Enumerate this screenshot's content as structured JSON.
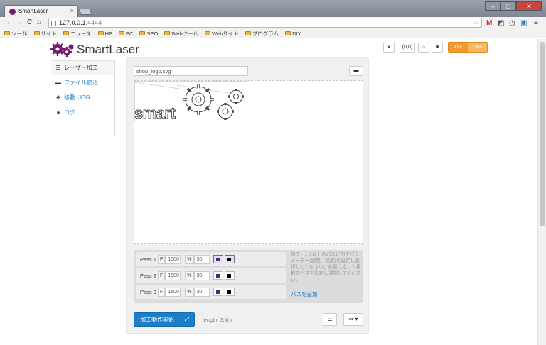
{
  "browser": {
    "tab_title": "SmartLaser",
    "tab_close": "×",
    "url_host": "127.0.0.1",
    "url_port": ":4444",
    "win_min": "–",
    "win_max": "□",
    "win_close": "✕",
    "back_icon": "←",
    "forward_icon": "→",
    "reload_icon": "C",
    "home_icon": "⌂",
    "star_icon": "☆",
    "menu_icon": "≡",
    "ext_gmail": "M",
    "ext_2": "◩",
    "ext_3": "◷",
    "ext_4": "▣"
  },
  "bookmarks": [
    "ツール",
    "サイト",
    "ニュース",
    "HP",
    "EC",
    "SEO",
    "Webツール",
    "Webサイト",
    "プログラム",
    "DIY"
  ],
  "app": {
    "brand": "SmartLaser",
    "sidebar": [
      {
        "label": "レーザー加工",
        "icon": "list-icon",
        "glyph": "☰"
      },
      {
        "label": "ファイル読込",
        "icon": "folder-icon",
        "glyph": "▬"
      },
      {
        "label": "移動･JOG",
        "icon": "move-icon",
        "glyph": "✥"
      },
      {
        "label": "ログ",
        "icon": "clock-icon",
        "glyph": "●"
      }
    ],
    "controls": {
      "pause": "⏸",
      "coords": "(0,0)",
      "home": "⌂",
      "stop": "■",
      "toggle_on": "ON",
      "toggle_off": "OFF"
    },
    "file": {
      "name": "shop_logo.svg",
      "open_icon": "▬"
    },
    "canvas_text": "smart",
    "passes": [
      {
        "label": "Pass 1",
        "f_tag": "F",
        "f_value": "1500",
        "pct_tag": "%",
        "pct_value": "30"
      },
      {
        "label": "Pass 2",
        "f_tag": "F",
        "f_value": "1500",
        "pct_tag": "%",
        "pct_value": "30"
      },
      {
        "label": "Pass 3",
        "f_tag": "F",
        "f_value": "1500",
        "pct_tag": "%",
        "pct_value": "30"
      }
    ],
    "hint": "加工、1つ以上のパスに加工パラメーター(速度、強度)を設定し選択してください。必要に応じて複数のパスを設定し選択してください。",
    "add_path": "パスを追加",
    "start_button": "加工動作開始",
    "start_icon": "⤢",
    "length": "length: 3.4m",
    "list_button": "☰",
    "share_button": "➦ ▾",
    "colors": {
      "accent": "#1a7ec8",
      "toggle": "#f39a2a",
      "logo": "#7a1a6e",
      "pass_purple": "#4b2a73",
      "pass_black": "#000000"
    }
  }
}
